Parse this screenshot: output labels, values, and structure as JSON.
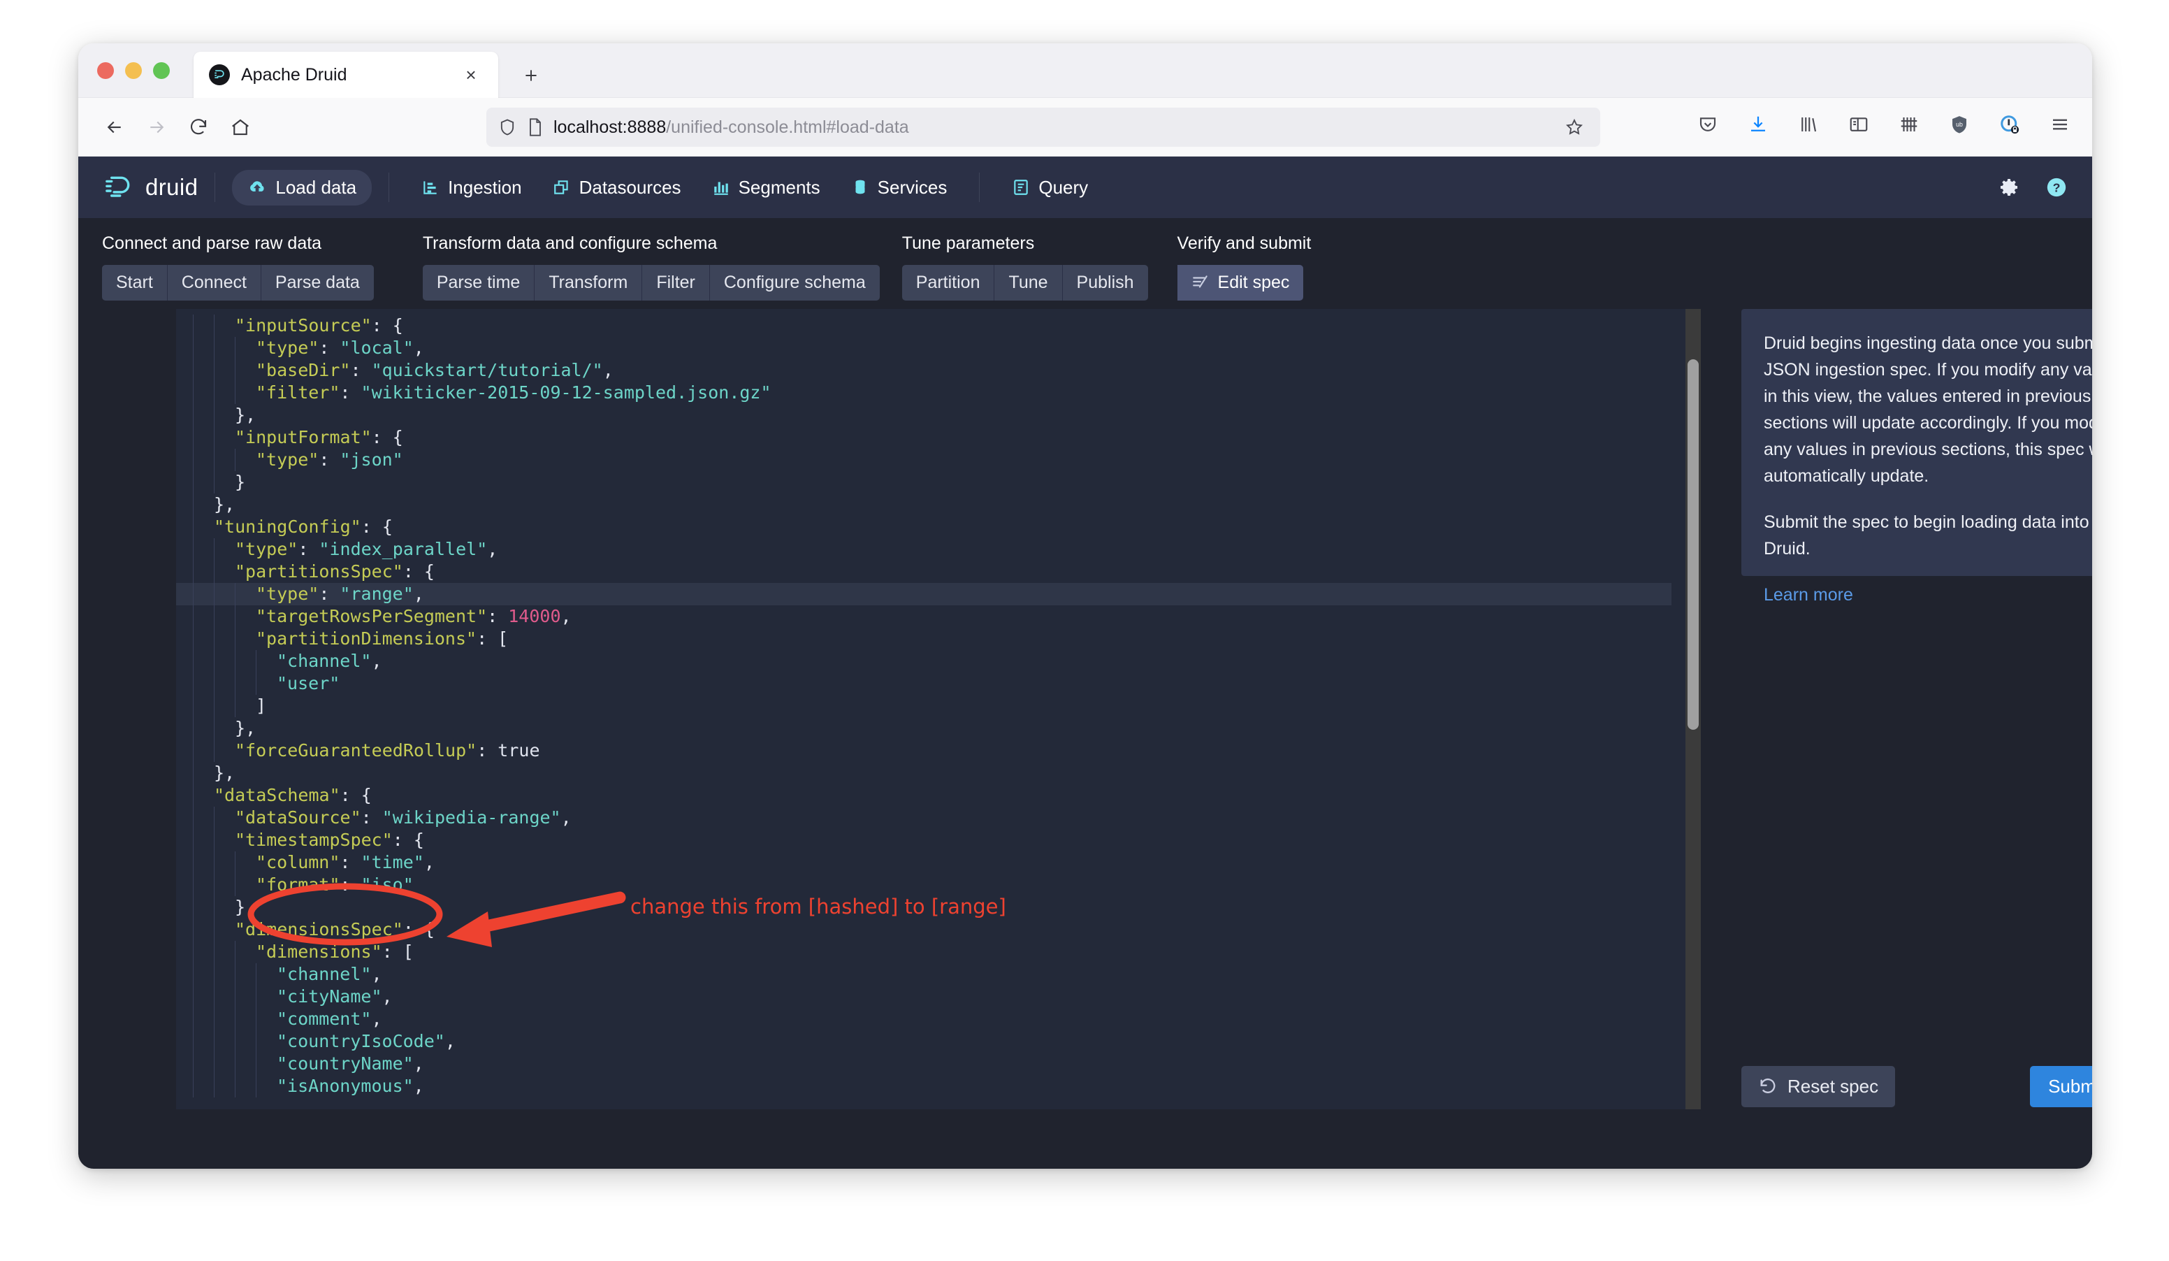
{
  "browser": {
    "tab": {
      "title": "Apache Druid",
      "favicon": "druid-favicon",
      "close": "×"
    },
    "new_tab_label": "+",
    "url": {
      "host": "localhost:8888",
      "path": "/unified-console.html#load-data",
      "full": "localhost:8888/unified-console.html#load-data"
    },
    "nav": {
      "back": "back-icon",
      "forward": "forward-icon",
      "reload": "reload-icon",
      "home": "home-icon"
    },
    "toolbar_icons": [
      "pocket-icon",
      "download-icon",
      "library-icon",
      "sidebar-icon",
      "containers-icon",
      "ublock-shield-icon",
      "privacy-badger-icon",
      "menu-icon"
    ]
  },
  "druid": {
    "brand": "druid",
    "nav_items": [
      {
        "label": "Load data",
        "icon": "load-data-icon",
        "active": true
      },
      {
        "label": "Ingestion",
        "icon": "ingestion-icon",
        "active": false
      },
      {
        "label": "Datasources",
        "icon": "datasources-icon",
        "active": false
      },
      {
        "label": "Segments",
        "icon": "segments-icon",
        "active": false
      },
      {
        "label": "Services",
        "icon": "services-icon",
        "active": false
      },
      {
        "label": "Query",
        "icon": "query-icon",
        "active": false
      }
    ],
    "header_right": [
      {
        "icon": "gear-icon",
        "name": "settings"
      },
      {
        "icon": "help-icon",
        "name": "help"
      }
    ],
    "stepper": [
      {
        "title": "Connect and parse raw data",
        "buttons": [
          {
            "label": "Start",
            "active": false
          },
          {
            "label": "Connect",
            "active": false
          },
          {
            "label": "Parse data",
            "active": false
          }
        ]
      },
      {
        "title": "Transform data and configure schema",
        "buttons": [
          {
            "label": "Parse time",
            "active": false
          },
          {
            "label": "Transform",
            "active": false
          },
          {
            "label": "Filter",
            "active": false
          },
          {
            "label": "Configure schema",
            "active": false
          }
        ]
      },
      {
        "title": "Tune parameters",
        "buttons": [
          {
            "label": "Partition",
            "active": false
          },
          {
            "label": "Tune",
            "active": false
          },
          {
            "label": "Publish",
            "active": false
          }
        ]
      },
      {
        "title": "Verify and submit",
        "buttons": [
          {
            "label": "Edit spec",
            "active": true,
            "icon": "edit-spec-icon"
          }
        ]
      }
    ],
    "info_panel": {
      "paragraph1": "Druid begins ingesting data once you submit a JSON ingestion spec. If you modify any values in this view, the values entered in previous sections will update accordingly. If you modify any values in previous sections, this spec will automatically update.",
      "paragraph2": "Submit the spec to begin loading data into Druid.",
      "learn_more": "Learn more"
    },
    "actions": {
      "reset_label": "Reset spec",
      "reset_icon": "undo-icon",
      "submit_label": "Submit",
      "submit_icon": "upload-cloud-icon"
    },
    "annotation": {
      "text": "change this from [hashed] to [range]",
      "color": "#ee4230",
      "arrow": "arrow-pointing-left",
      "highlight_shape": "ellipse-around-type-range"
    },
    "editor": {
      "language": "json",
      "highlighted_line": "\"type\": \"range\",",
      "colors": {
        "key": "#c5cc55",
        "string": "#6dd5c8",
        "number": "#e05b8c",
        "background": "#232939"
      },
      "lines": [
        {
          "indent": 2,
          "tokens": [
            {
              "t": "k",
              "v": "\"inputSource\""
            },
            {
              "t": "p",
              "v": ": {"
            }
          ]
        },
        {
          "indent": 3,
          "tokens": [
            {
              "t": "k",
              "v": "\"type\""
            },
            {
              "t": "p",
              "v": ": "
            },
            {
              "t": "s",
              "v": "\"local\""
            },
            {
              "t": "p",
              "v": ","
            }
          ]
        },
        {
          "indent": 3,
          "tokens": [
            {
              "t": "k",
              "v": "\"baseDir\""
            },
            {
              "t": "p",
              "v": ": "
            },
            {
              "t": "s",
              "v": "\"quickstart/tutorial/\""
            },
            {
              "t": "p",
              "v": ","
            }
          ]
        },
        {
          "indent": 3,
          "tokens": [
            {
              "t": "k",
              "v": "\"filter\""
            },
            {
              "t": "p",
              "v": ": "
            },
            {
              "t": "s",
              "v": "\"wikiticker-2015-09-12-sampled.json.gz\""
            }
          ]
        },
        {
          "indent": 2,
          "tokens": [
            {
              "t": "p",
              "v": "},"
            }
          ]
        },
        {
          "indent": 2,
          "tokens": [
            {
              "t": "k",
              "v": "\"inputFormat\""
            },
            {
              "t": "p",
              "v": ": {"
            }
          ]
        },
        {
          "indent": 3,
          "tokens": [
            {
              "t": "k",
              "v": "\"type\""
            },
            {
              "t": "p",
              "v": ": "
            },
            {
              "t": "s",
              "v": "\"json\""
            }
          ]
        },
        {
          "indent": 2,
          "tokens": [
            {
              "t": "p",
              "v": "}"
            }
          ]
        },
        {
          "indent": 1,
          "tokens": [
            {
              "t": "p",
              "v": "},"
            }
          ]
        },
        {
          "indent": 1,
          "tokens": [
            {
              "t": "k",
              "v": "\"tuningConfig\""
            },
            {
              "t": "p",
              "v": ": {"
            }
          ]
        },
        {
          "indent": 2,
          "tokens": [
            {
              "t": "k",
              "v": "\"type\""
            },
            {
              "t": "p",
              "v": ": "
            },
            {
              "t": "s",
              "v": "\"index_parallel\""
            },
            {
              "t": "p",
              "v": ","
            }
          ]
        },
        {
          "indent": 2,
          "tokens": [
            {
              "t": "k",
              "v": "\"partitionsSpec\""
            },
            {
              "t": "p",
              "v": ": {"
            }
          ]
        },
        {
          "indent": 3,
          "highlight": true,
          "tokens": [
            {
              "t": "k",
              "v": "\"type\""
            },
            {
              "t": "p",
              "v": ": "
            },
            {
              "t": "s",
              "v": "\"range\""
            },
            {
              "t": "p",
              "v": ","
            }
          ]
        },
        {
          "indent": 3,
          "tokens": [
            {
              "t": "k",
              "v": "\"targetRowsPerSegment\""
            },
            {
              "t": "p",
              "v": ": "
            },
            {
              "t": "n",
              "v": "14000"
            },
            {
              "t": "p",
              "v": ","
            }
          ]
        },
        {
          "indent": 3,
          "tokens": [
            {
              "t": "k",
              "v": "\"partitionDimensions\""
            },
            {
              "t": "p",
              "v": ": ["
            }
          ]
        },
        {
          "indent": 4,
          "tokens": [
            {
              "t": "s",
              "v": "\"channel\""
            },
            {
              "t": "p",
              "v": ","
            }
          ]
        },
        {
          "indent": 4,
          "tokens": [
            {
              "t": "s",
              "v": "\"user\""
            }
          ]
        },
        {
          "indent": 3,
          "tokens": [
            {
              "t": "p",
              "v": "]"
            }
          ]
        },
        {
          "indent": 2,
          "tokens": [
            {
              "t": "p",
              "v": "},"
            }
          ]
        },
        {
          "indent": 2,
          "tokens": [
            {
              "t": "k",
              "v": "\"forceGuaranteedRollup\""
            },
            {
              "t": "p",
              "v": ": "
            },
            {
              "t": "b",
              "v": "true"
            }
          ]
        },
        {
          "indent": 1,
          "tokens": [
            {
              "t": "p",
              "v": "},"
            }
          ]
        },
        {
          "indent": 1,
          "tokens": [
            {
              "t": "k",
              "v": "\"dataSchema\""
            },
            {
              "t": "p",
              "v": ": {"
            }
          ]
        },
        {
          "indent": 2,
          "tokens": [
            {
              "t": "k",
              "v": "\"dataSource\""
            },
            {
              "t": "p",
              "v": ": "
            },
            {
              "t": "s",
              "v": "\"wikipedia-range\""
            },
            {
              "t": "p",
              "v": ","
            }
          ]
        },
        {
          "indent": 2,
          "tokens": [
            {
              "t": "k",
              "v": "\"timestampSpec\""
            },
            {
              "t": "p",
              "v": ": {"
            }
          ]
        },
        {
          "indent": 3,
          "tokens": [
            {
              "t": "k",
              "v": "\"column\""
            },
            {
              "t": "p",
              "v": ": "
            },
            {
              "t": "s",
              "v": "\"time\""
            },
            {
              "t": "p",
              "v": ","
            }
          ]
        },
        {
          "indent": 3,
          "tokens": [
            {
              "t": "k",
              "v": "\"format\""
            },
            {
              "t": "p",
              "v": ": "
            },
            {
              "t": "s",
              "v": "\"iso\""
            }
          ]
        },
        {
          "indent": 2,
          "tokens": [
            {
              "t": "p",
              "v": "},"
            }
          ]
        },
        {
          "indent": 2,
          "tokens": [
            {
              "t": "k",
              "v": "\"dimensionsSpec\""
            },
            {
              "t": "p",
              "v": ": {"
            }
          ]
        },
        {
          "indent": 3,
          "tokens": [
            {
              "t": "k",
              "v": "\"dimensions\""
            },
            {
              "t": "p",
              "v": ": ["
            }
          ]
        },
        {
          "indent": 4,
          "tokens": [
            {
              "t": "s",
              "v": "\"channel\""
            },
            {
              "t": "p",
              "v": ","
            }
          ]
        },
        {
          "indent": 4,
          "tokens": [
            {
              "t": "s",
              "v": "\"cityName\""
            },
            {
              "t": "p",
              "v": ","
            }
          ]
        },
        {
          "indent": 4,
          "tokens": [
            {
              "t": "s",
              "v": "\"comment\""
            },
            {
              "t": "p",
              "v": ","
            }
          ]
        },
        {
          "indent": 4,
          "tokens": [
            {
              "t": "s",
              "v": "\"countryIsoCode\""
            },
            {
              "t": "p",
              "v": ","
            }
          ]
        },
        {
          "indent": 4,
          "tokens": [
            {
              "t": "s",
              "v": "\"countryName\""
            },
            {
              "t": "p",
              "v": ","
            }
          ]
        },
        {
          "indent": 4,
          "tokens": [
            {
              "t": "s",
              "v": "\"isAnonymous\""
            },
            {
              "t": "p",
              "v": ","
            }
          ]
        }
      ]
    }
  }
}
